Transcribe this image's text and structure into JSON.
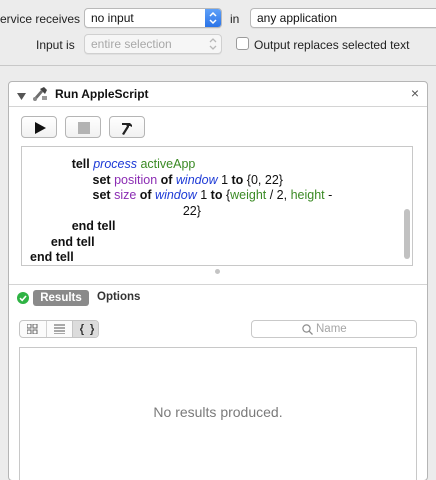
{
  "settings": {
    "service_receives_label": "ervice receives",
    "service_receives_value": "no input",
    "in_label": "in",
    "application_value": "any application",
    "input_is_label": "Input is",
    "input_is_value": "entire selection",
    "output_replaces_label": "Output replaces selected text"
  },
  "action": {
    "title": "Run AppleScript",
    "close_glyph": "×",
    "code_lines": [
      [
        {
          "t": "            "
        },
        {
          "t": "tell ",
          "c": "kw"
        },
        {
          "t": "process ",
          "c": "cls"
        },
        {
          "t": "activeApp",
          "c": "var"
        }
      ],
      [
        {
          "t": "                  "
        },
        {
          "t": "set ",
          "c": "kw"
        },
        {
          "t": "position ",
          "c": "prop"
        },
        {
          "t": "of ",
          "c": "kw"
        },
        {
          "t": "window ",
          "c": "cls"
        },
        {
          "t": "1 "
        },
        {
          "t": "to ",
          "c": "kw"
        },
        {
          "t": "{0, 22}"
        }
      ],
      [
        {
          "t": "                  "
        },
        {
          "t": "set ",
          "c": "kw"
        },
        {
          "t": "size ",
          "c": "prop"
        },
        {
          "t": "of ",
          "c": "kw"
        },
        {
          "t": "window ",
          "c": "cls"
        },
        {
          "t": "1 "
        },
        {
          "t": "to ",
          "c": "kw"
        },
        {
          "t": "{"
        },
        {
          "t": "weight",
          "c": "var"
        },
        {
          "t": " / 2, "
        },
        {
          "t": "height",
          "c": "var"
        },
        {
          "t": " -"
        }
      ],
      [
        {
          "t": "                                            "
        },
        {
          "t": "22}"
        }
      ],
      [
        {
          "t": "            "
        },
        {
          "t": "end tell",
          "c": "kw"
        }
      ],
      [
        {
          "t": "      "
        },
        {
          "t": "end tell",
          "c": "kw"
        }
      ],
      [
        {
          "t": "end tell",
          "c": "kw"
        }
      ]
    ],
    "tabs": {
      "results": "Results",
      "options": "Options"
    },
    "search_placeholder": "Name",
    "empty_message": "No results produced."
  },
  "colors": {
    "accent": "#2a73e8",
    "ok_green": "#2fb344"
  }
}
